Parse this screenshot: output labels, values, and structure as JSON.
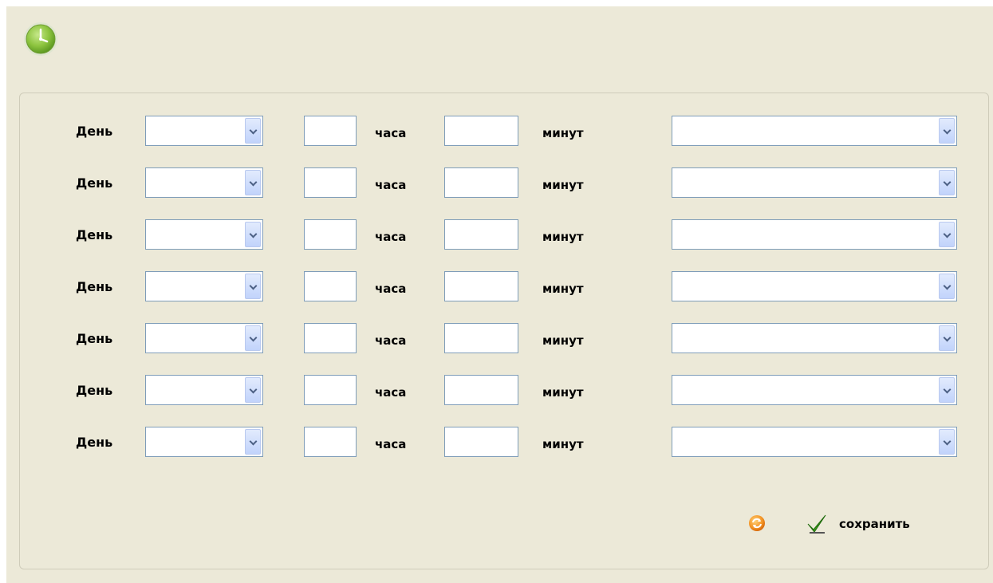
{
  "header": {
    "icon": "clock-icon"
  },
  "schedule": {
    "rows": [
      {
        "day_label": "День",
        "day_value": "",
        "hours_value": "",
        "hours_label": "часа",
        "minutes_value": "",
        "minutes_label": "минут",
        "action_value": ""
      },
      {
        "day_label": "День",
        "day_value": "",
        "hours_value": "",
        "hours_label": "часа",
        "minutes_value": "",
        "minutes_label": "минут",
        "action_value": ""
      },
      {
        "day_label": "День",
        "day_value": "",
        "hours_value": "",
        "hours_label": "часа",
        "minutes_value": "",
        "minutes_label": "минут",
        "action_value": ""
      },
      {
        "day_label": "День",
        "day_value": "",
        "hours_value": "",
        "hours_label": "часа",
        "minutes_value": "",
        "minutes_label": "минут",
        "action_value": ""
      },
      {
        "day_label": "День",
        "day_value": "",
        "hours_value": "",
        "hours_label": "часа",
        "minutes_value": "",
        "minutes_label": "минут",
        "action_value": ""
      },
      {
        "day_label": "День",
        "day_value": "",
        "hours_value": "",
        "hours_label": "часа",
        "minutes_value": "",
        "minutes_label": "минут",
        "action_value": ""
      },
      {
        "day_label": "День",
        "day_value": "",
        "hours_value": "",
        "hours_label": "часа",
        "minutes_value": "",
        "minutes_label": "минут",
        "action_value": ""
      }
    ]
  },
  "actions": {
    "reset_icon": "reset-icon",
    "save_icon": "checkmark-icon",
    "save_label": "сохранить"
  },
  "colors": {
    "background": "#ece9d8",
    "field_border": "#7f9db9",
    "clock_green": "#8dc43f",
    "reset_orange": "#f39324",
    "check_green": "#3a9a1a"
  }
}
